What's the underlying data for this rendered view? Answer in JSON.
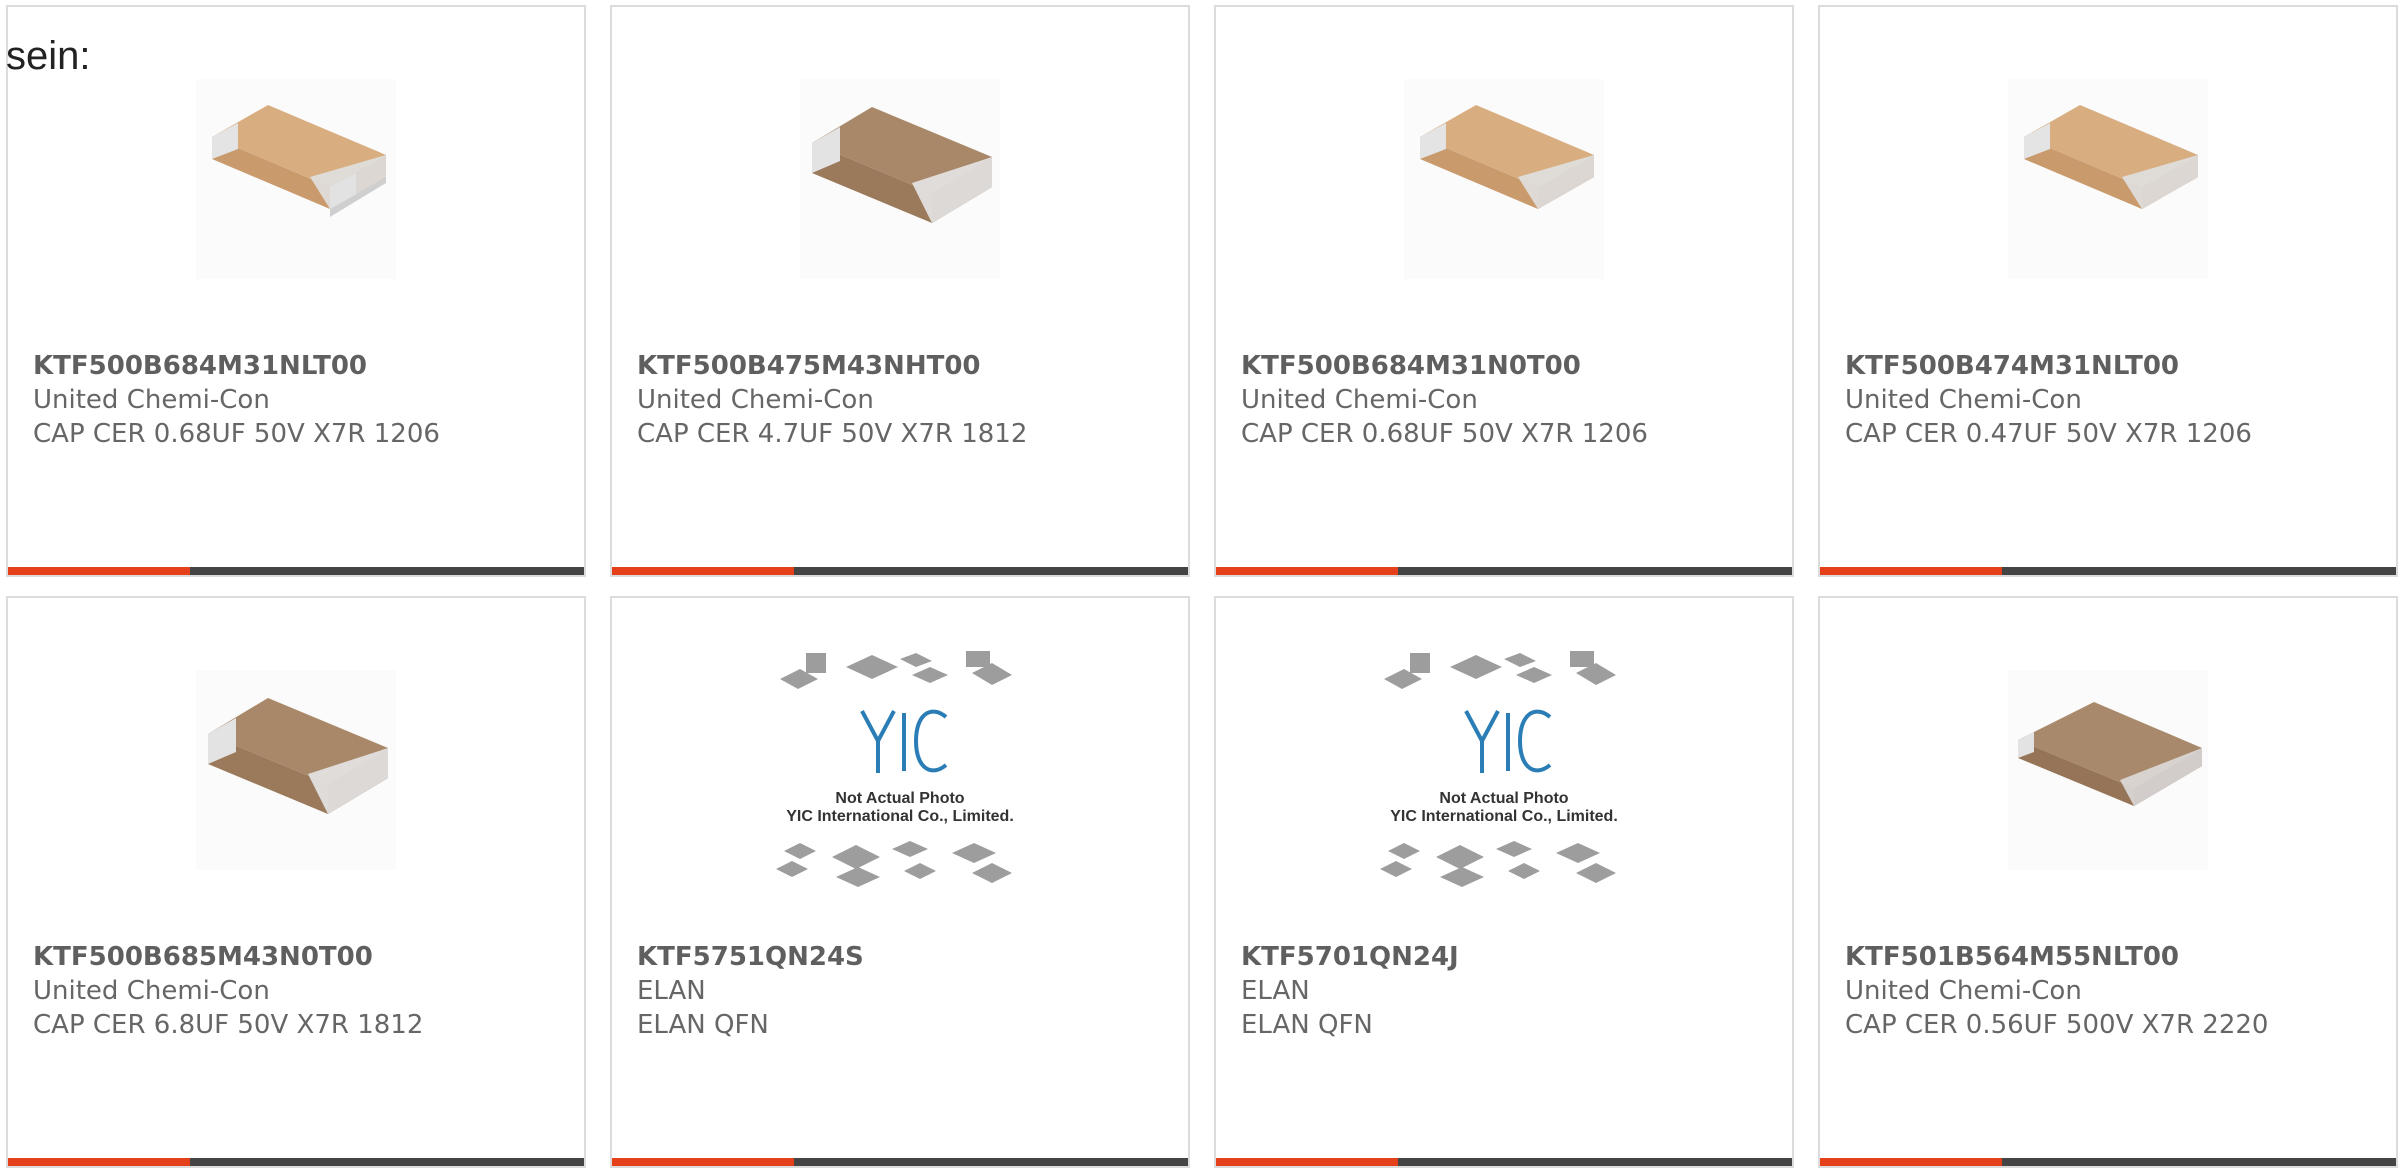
{
  "heading": "sein:",
  "colors": {
    "accent": "#e5401a",
    "bar": "#444444",
    "card_border": "#dcdcdc",
    "text": "#666666"
  },
  "products": [
    {
      "part": "KTF500B684M31NLT00",
      "maker": "United Chemi-Con",
      "desc": "CAP CER 0.68UF 50V X7R 1206",
      "image": "capacitor-chip-photo"
    },
    {
      "part": "KTF500B475M43NHT00",
      "maker": "United Chemi-Con",
      "desc": "CAP CER 4.7UF 50V X7R 1812",
      "image": "capacitor-chip-photo"
    },
    {
      "part": "KTF500B684M31N0T00",
      "maker": "United Chemi-Con",
      "desc": "CAP CER 0.68UF 50V X7R 1206",
      "image": "capacitor-chip-photo"
    },
    {
      "part": "KTF500B474M31NLT00",
      "maker": "United Chemi-Con",
      "desc": "CAP CER 0.47UF 50V X7R 1206",
      "image": "capacitor-chip-photo"
    },
    {
      "part": "KTF500B685M43N0T00",
      "maker": "United Chemi-Con",
      "desc": "CAP CER 6.8UF 50V X7R 1812",
      "image": "capacitor-chip-photo"
    },
    {
      "part": "KTF5751QN24S",
      "maker": "ELAN",
      "desc": "ELAN QFN",
      "image": "not-actual-photo-placeholder",
      "placeholder_lines": [
        "Not Actual Photo",
        "YIC International Co., Limited."
      ]
    },
    {
      "part": "KTF5701QN24J",
      "maker": "ELAN",
      "desc": "ELAN QFN",
      "image": "not-actual-photo-placeholder",
      "placeholder_lines": [
        "Not Actual Photo",
        "YIC International Co., Limited."
      ]
    },
    {
      "part": "KTF501B564M55NLT00",
      "maker": "United Chemi-Con",
      "desc": "CAP CER 0.56UF 500V X7R 2220",
      "image": "capacitor-chip-photo"
    }
  ]
}
